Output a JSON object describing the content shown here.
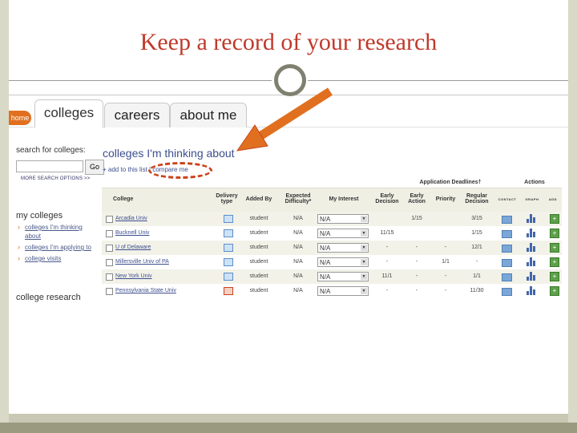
{
  "slide": {
    "title": "Keep a record of  your research"
  },
  "tabs": {
    "home": "home",
    "items": [
      "colleges",
      "careers",
      "about me"
    ]
  },
  "sidebar": {
    "search_label": "search for colleges:",
    "search_value": "",
    "go_label": "Go",
    "more_options": "MORE SEARCH OPTIONS >>",
    "my_colleges": "my colleges",
    "links": [
      "colleges I'm thinking about",
      "colleges I'm applying to",
      "college visits"
    ],
    "college_research": "college research"
  },
  "main": {
    "heading": "colleges I'm thinking about",
    "add_link": "+ add to this list",
    "separator": "|",
    "compare_link": "compare me"
  },
  "table": {
    "group_deadlines": "Application Deadlines†",
    "group_actions": "Actions",
    "headers": {
      "college": "College",
      "delivery": "Delivery type",
      "added_by": "Added By",
      "difficulty": "Expected Difficulty*",
      "interest": "My Interest",
      "early_decision": "Early Decision",
      "early_action": "Early Action",
      "priority": "Priority",
      "regular": "Regular Decision",
      "contact": "CONTACT",
      "graph": "GRAPH",
      "add": "ADD"
    },
    "rows": [
      {
        "college": "Arcadia Univ",
        "added_by": "student",
        "difficulty": "N/A",
        "interest": "N/A",
        "ed": "",
        "ea": "1/15",
        "priority": "",
        "regular": "3/15",
        "delivery_color": "blue"
      },
      {
        "college": "Bucknell Univ",
        "added_by": "student",
        "difficulty": "N/A",
        "interest": "N/A",
        "ed": "11/15",
        "ea": "",
        "priority": "",
        "regular": "1/15",
        "delivery_color": "blue"
      },
      {
        "college": "U of Delaware",
        "added_by": "student",
        "difficulty": "N/A",
        "interest": "N/A",
        "ed": "-",
        "ea": "-",
        "priority": "-",
        "regular": "12/1",
        "delivery_color": "blue"
      },
      {
        "college": "Millersville Univ of PA",
        "added_by": "student",
        "difficulty": "N/A",
        "interest": "N/A",
        "ed": "-",
        "ea": "-",
        "priority": "1/1",
        "regular": "-",
        "delivery_color": "blue"
      },
      {
        "college": "New York Univ",
        "added_by": "student",
        "difficulty": "N/A",
        "interest": "N/A",
        "ed": "11/1",
        "ea": "-",
        "priority": "-",
        "regular": "1/1",
        "delivery_color": "blue"
      },
      {
        "college": "Pennsylvania State Univ",
        "added_by": "student",
        "difficulty": "N/A",
        "interest": "N/A",
        "ed": "-",
        "ea": "-",
        "priority": "-",
        "regular": "11/30",
        "delivery_color": "red"
      }
    ]
  },
  "colors": {
    "title": "#c0392b",
    "link": "#3d4f8f",
    "arrow": "#e0701f",
    "home_tab": "#e0701f",
    "frame": "#d9d9c8"
  }
}
